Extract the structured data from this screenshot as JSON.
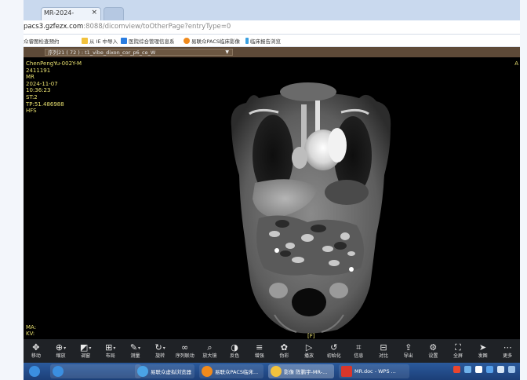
{
  "browser": {
    "tab_title": "MR-2024-",
    "tab_close": "×",
    "url_host": "pacs3.gzfezx.com",
    "url_rest": ":8088/dicomview/toOtherPage?entryType=0",
    "bookmarks": [
      {
        "label": "众睿图检查预约",
        "color": "#5a8ad6"
      },
      {
        "label": "从 IE 中导入",
        "color": "#f2c23d"
      },
      {
        "label": "医院综合管理信息系",
        "color": "#2a7de1"
      },
      {
        "label": "易联众PACS临床影像",
        "color": "#f08a1c"
      },
      {
        "label": "临床报告浏览",
        "color": "#3aa0e0"
      }
    ]
  },
  "viewer": {
    "series_label": "序列21 ( 72 ) : t1_vibe_dixon_cor_p6_ce_W",
    "series_caret": "▼",
    "info_lines": [
      "ChenPengYu-002Y-M",
      "2411191",
      "MR",
      "2024-11-07",
      "10:36:23",
      "ST:2",
      "TP:51.486988",
      "HFS"
    ],
    "corner_right": "A",
    "bottom_lines": [
      "MA:",
      "KV:"
    ],
    "orientation_bottom": "[F]"
  },
  "toolbar": {
    "tools": [
      {
        "label": "移动",
        "icon": "move-icon",
        "glyph": "✥",
        "drop": false
      },
      {
        "label": "缩放",
        "icon": "zoom-icon",
        "glyph": "⊕",
        "drop": true
      },
      {
        "label": "调窗",
        "icon": "window-level-icon",
        "glyph": "◩",
        "drop": true
      },
      {
        "label": "布局",
        "icon": "layout-icon",
        "glyph": "⊞",
        "drop": true
      },
      {
        "label": "测量",
        "icon": "measure-icon",
        "glyph": "✎",
        "drop": true
      },
      {
        "label": "旋转",
        "icon": "rotate-icon",
        "glyph": "↻",
        "drop": true
      },
      {
        "label": "序列联动",
        "icon": "link-icon",
        "glyph": "∞",
        "drop": false
      },
      {
        "label": "放大镜",
        "icon": "magnifier-icon",
        "glyph": "⌕",
        "drop": false
      },
      {
        "label": "反色",
        "icon": "invert-icon",
        "glyph": "◑",
        "drop": false
      },
      {
        "label": "增强",
        "icon": "enhance-icon",
        "glyph": "≡",
        "drop": false
      },
      {
        "label": "伪彩",
        "icon": "palette-icon",
        "glyph": "✿",
        "drop": false
      },
      {
        "label": "播放",
        "icon": "play-icon",
        "glyph": "▷",
        "drop": false
      },
      {
        "label": "初始化",
        "icon": "reset-icon",
        "glyph": "↺",
        "drop": false
      },
      {
        "label": "信息",
        "icon": "info-icon",
        "glyph": "⌗",
        "drop": false
      },
      {
        "label": "对比",
        "icon": "compare-icon",
        "glyph": "⊟",
        "drop": false
      },
      {
        "label": "导出",
        "icon": "export-icon",
        "glyph": "⇪",
        "drop": false
      },
      {
        "label": "设置",
        "icon": "settings-icon",
        "glyph": "⚙",
        "drop": false
      },
      {
        "label": "全屏",
        "icon": "fullscreen-icon",
        "glyph": "⛶",
        "drop": false
      },
      {
        "label": "发图",
        "icon": "send-icon",
        "glyph": "➤",
        "drop": false
      },
      {
        "label": "更多",
        "icon": "more-icon",
        "glyph": "⋯",
        "drop": false
      }
    ]
  },
  "taskbar": {
    "items": [
      {
        "label": "",
        "icon": "ie-icon",
        "color": "#3b8fe0"
      },
      {
        "label": "",
        "icon": "ie-window-icon",
        "color": "#3b8fe0"
      },
      {
        "label": "易联众虚拟浏览器",
        "icon": "browser-app-icon",
        "color": "#4aa3e6"
      },
      {
        "label": "易联众PACS临床...",
        "icon": "pacs-app-icon",
        "color": "#f08a1c"
      },
      {
        "label": "影像 陈鹏宇-MR-...",
        "icon": "chrome-app-icon",
        "color": "#f2c23d"
      },
      {
        "label": "MR.doc - WPS ...",
        "icon": "wps-app-icon",
        "color": "#d9362b"
      }
    ],
    "tray": [
      {
        "icon": "sogou-icon",
        "color": "#e9452d"
      },
      {
        "icon": "network-icon",
        "color": "#6fb1ea"
      },
      {
        "icon": "input-icon",
        "color": "#ffffff"
      },
      {
        "icon": "security-icon",
        "color": "#56a0ea"
      },
      {
        "icon": "volume-icon",
        "color": "#d8e6f5"
      },
      {
        "icon": "extra-icon",
        "color": "#9ec3ea"
      }
    ]
  }
}
